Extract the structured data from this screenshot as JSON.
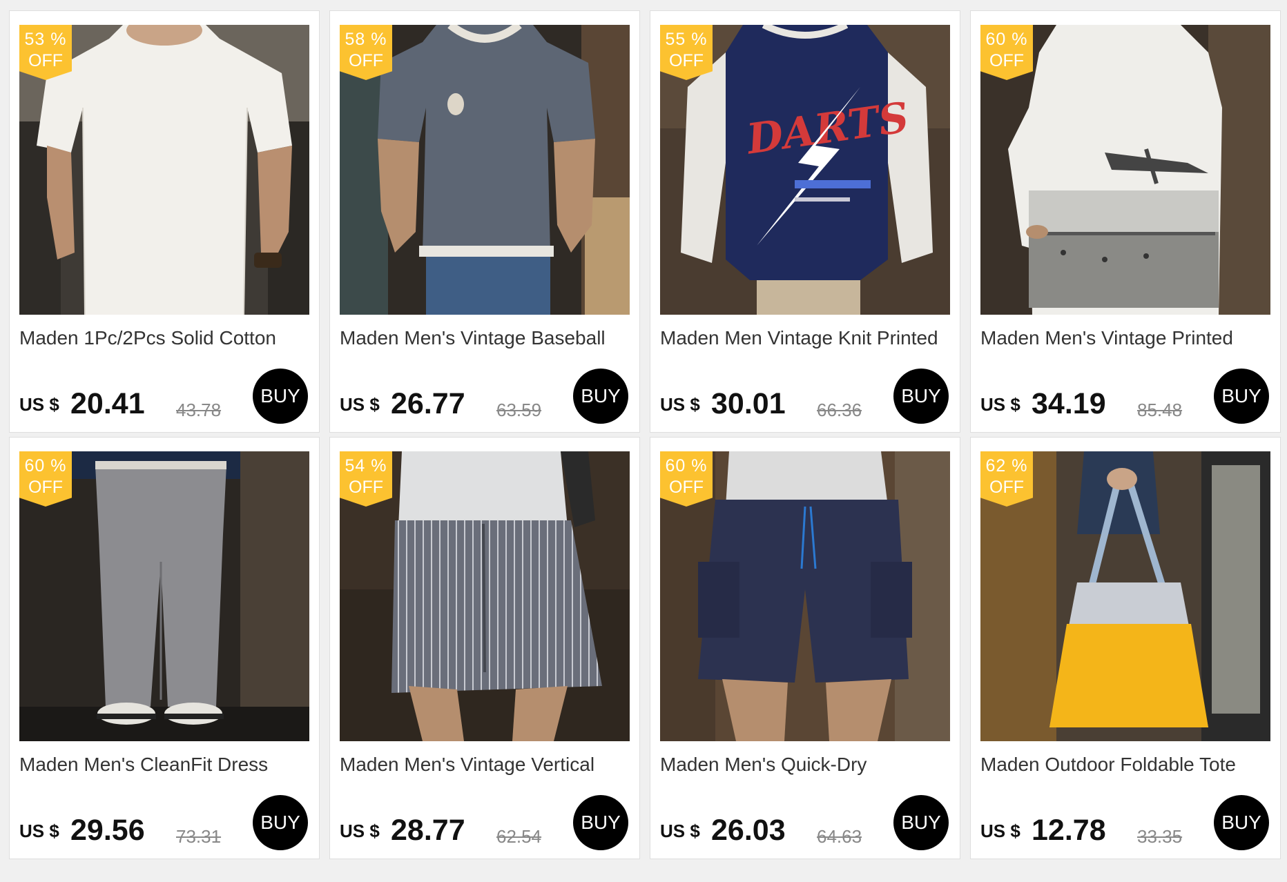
{
  "currency_label": "US $",
  "badge_off_label": "OFF",
  "buy_label": "BUY",
  "colors": {
    "badge": "#fcc230",
    "buy_button": "#000000",
    "card_background": "#ffffff",
    "page_background": "#f0f0f0"
  },
  "products": [
    {
      "title": "Maden 1Pc/2Pcs Solid Cotton",
      "discount": "53 %",
      "price": "20.41",
      "original_price": "43.78",
      "image": "white-tshirt"
    },
    {
      "title": "Maden Men's Vintage Baseball",
      "discount": "58 %",
      "price": "26.77",
      "original_price": "63.59",
      "image": "grey-henley-shirt"
    },
    {
      "title": "Maden Men Vintage Knit Printed",
      "discount": "55 %",
      "price": "30.01",
      "original_price": "66.36",
      "image": "darts-raglan-shirt"
    },
    {
      "title": "Maden Men's Vintage Printed",
      "discount": "60 %",
      "price": "34.19",
      "original_price": "85.48",
      "image": "printed-white-shirt"
    },
    {
      "title": "Maden Men's CleanFit Dress",
      "discount": "60 %",
      "price": "29.56",
      "original_price": "73.31",
      "image": "grey-trousers"
    },
    {
      "title": "Maden Men's Vintage Vertical",
      "discount": "54 %",
      "price": "28.77",
      "original_price": "62.54",
      "image": "striped-shorts"
    },
    {
      "title": "Maden Men's Quick-Dry",
      "discount": "60 %",
      "price": "26.03",
      "original_price": "64.63",
      "image": "navy-cargo-shorts"
    },
    {
      "title": "Maden Outdoor Foldable Tote",
      "discount": "62 %",
      "price": "12.78",
      "original_price": "33.35",
      "image": "yellow-tote-bag"
    }
  ]
}
